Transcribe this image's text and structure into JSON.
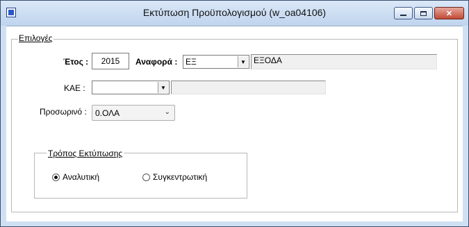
{
  "window": {
    "title": "Εκτύπωση Προϋπολογισμού   (w_oa04106)",
    "min_glyph": "",
    "max_glyph": "",
    "close_glyph": "✕"
  },
  "options_group": {
    "label": "Επιλογές"
  },
  "form": {
    "year_label": "Έτος :",
    "year_value": "2015",
    "report_label": "Αναφορά :",
    "report_code": "ΕΞ",
    "report_desc": "ΕΞΟΔΑ",
    "kae_label": "ΚΑΕ :",
    "kae_code": "",
    "kae_desc": "",
    "temp_label": "Προσωρινό :",
    "temp_value": "0.ΟΛΑ"
  },
  "print_mode": {
    "label": "Τρόπος  Εκτύπωσης",
    "options": [
      {
        "label": "Αναλυτική",
        "selected": true
      },
      {
        "label": "Συγκεντρωτική",
        "selected": false
      }
    ]
  },
  "icons": {
    "dropdown_arrow": "▼",
    "chevron": "⌄"
  }
}
